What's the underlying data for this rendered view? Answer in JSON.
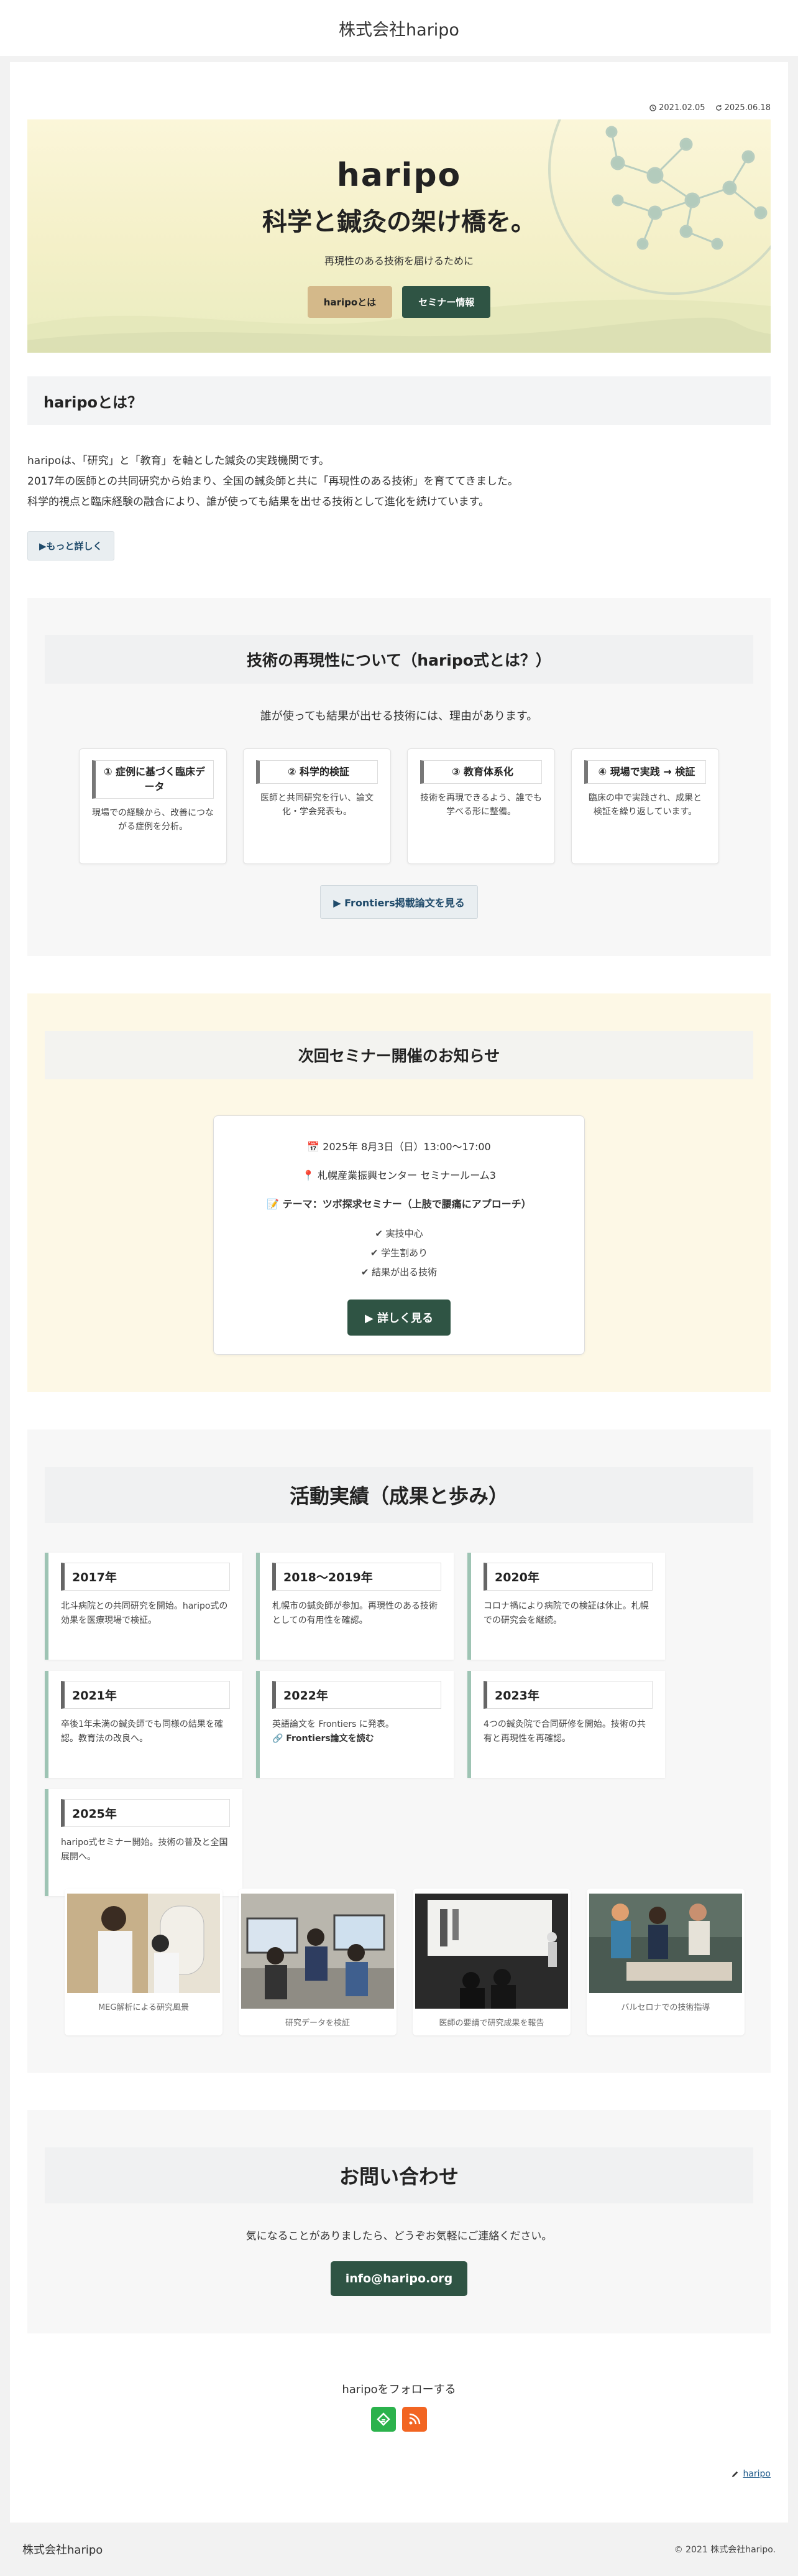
{
  "site": {
    "title": "株式会社haripo"
  },
  "dates": {
    "published": "2021.02.05",
    "updated": "2025.06.18"
  },
  "hero": {
    "title": "haripo",
    "subtitle": "科学と鍼灸の架け橋を。",
    "tagline": "再現性のある技術を届けるために",
    "btn_about": "haripoとは",
    "btn_seminar": "セミナー情報"
  },
  "about": {
    "heading": "haripoとは？",
    "lines": [
      "haripoは、「研究」と「教育」を軸とした鍼灸の実践機関です。",
      "2017年の医師との共同研究から始まり、全国の鍼灸師と共に「再現性のある技術」を育ててきました。",
      "科学的視点と臨床経験の融合により、誰が使っても結果を出せる技術として進化を続けています。"
    ],
    "more_btn": "▶もっと詳しく"
  },
  "tech": {
    "heading": "技術の再現性について（haripo式とは？）",
    "lead": "誰が使っても結果が出せる技術には、理由があります。",
    "cards": [
      {
        "title": "① 症例に基づく臨床データ",
        "body": "現場での経験から、改善につながる症例を分析。"
      },
      {
        "title": "② 科学的検証",
        "body": "医師と共同研究を行い、論文化・学会発表も。"
      },
      {
        "title": "③ 教育体系化",
        "body": "技術を再現できるよう、誰でも学べる形に整備。"
      },
      {
        "title": "④ 現場で実践 → 検証",
        "body": "臨床の中で実践され、成果と検証を繰り返しています。"
      }
    ],
    "button": "▶ Frontiers掲載論文を見る"
  },
  "seminar": {
    "heading": "次回セミナー開催のお知らせ",
    "date": "📅 2025年 8月3日（日）13:00〜17:00",
    "place": "📍 札幌産業振興センター セミナールーム3",
    "theme": "📝 テーマ：ツボ探求セミナー（上肢で腰痛にアプローチ）",
    "checks": [
      "✔ 実技中心",
      "✔ 学生割あり",
      "✔ 結果が出る技術"
    ],
    "button": "▶ 詳しく見る"
  },
  "history": {
    "heading": "活動実績（成果と歩み）",
    "items": [
      {
        "year": "2017年",
        "body": "北斗病院との共同研究を開始。haripo式の効果を医療現場で検証。",
        "link": ""
      },
      {
        "year": "2018〜2019年",
        "body": "札幌市の鍼灸師が参加。再現性のある技術としての有用性を確認。",
        "link": ""
      },
      {
        "year": "2020年",
        "body": "コロナ禍により病院での検証は休止。札幌での研究会を継続。",
        "link": ""
      },
      {
        "year": "2021年",
        "body": "卒後1年未満の鍼灸師でも同様の結果を確認。教育法の改良へ。",
        "link": ""
      },
      {
        "year": "2022年",
        "body": "英語論文を Frontiers に発表。",
        "link": "🔗 Frontiers論文を読む"
      },
      {
        "year": "2023年",
        "body": "4つの鍼灸院で合同研修を開始。技術の共有と再現性を再確認。",
        "link": ""
      },
      {
        "year": "2025年",
        "body": "haripo式セミナー開始。技術の普及と全国展開へ。",
        "link": ""
      }
    ],
    "photos": [
      {
        "caption": "MEG解析による研究風景"
      },
      {
        "caption": "研究データを検証"
      },
      {
        "caption": "医師の要請で研究成果を報告"
      },
      {
        "caption": "バルセロナでの技術指導"
      }
    ]
  },
  "contact": {
    "heading": "お問い合わせ",
    "lead": "気になることがありましたら、どうぞお気軽にご連絡ください。",
    "email": "info@haripo.org"
  },
  "follow": {
    "label": "haripoをフォローする"
  },
  "author": {
    "name": "haripo"
  },
  "footer": {
    "left": "株式会社haripo",
    "right": "© 2021 株式会社haripo."
  },
  "colors": {
    "accent_green": "#2f5444",
    "accent_tan": "#d4b98a",
    "feedly": "#2bb24c",
    "rss": "#f26522"
  }
}
